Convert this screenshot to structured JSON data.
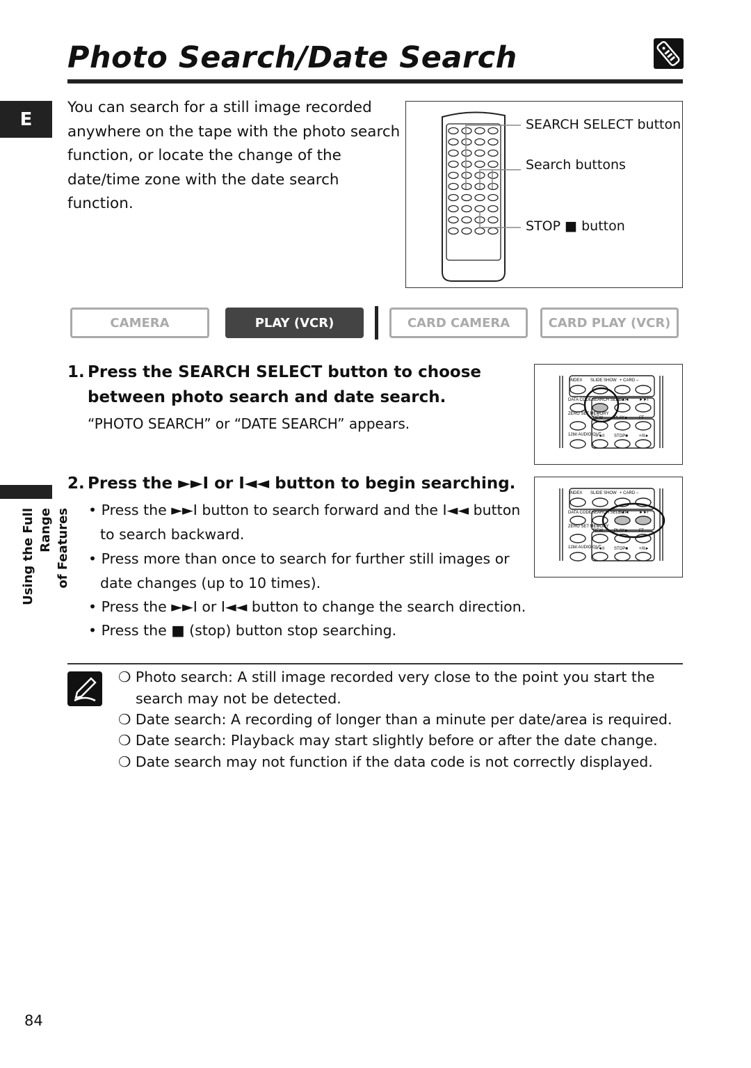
{
  "title": "Photo Search/Date Search",
  "language_tab": "E",
  "intro": "You can search for a still image recorded anywhere on the tape with the photo search function, or locate the change of the date/time zone with the date search function.",
  "diagram": {
    "labels": [
      "SEARCH SELECT button",
      "Search buttons",
      "STOP ■ button"
    ]
  },
  "modes": [
    {
      "label": "CAMERA",
      "active": false
    },
    {
      "label": "PLAY (VCR)",
      "active": true
    },
    {
      "label": "CARD CAMERA",
      "active": false
    },
    {
      "label": "CARD PLAY (VCR)",
      "active": false
    }
  ],
  "steps": [
    {
      "num": "1.",
      "text": "Press the SEARCH SELECT button to choose between photo search and date search.",
      "sub": "“PHOTO SEARCH” or “DATE SEARCH” appears."
    },
    {
      "num": "2.",
      "text": "Press the ►►I or I◄◄ button to begin searching.",
      "bullets": [
        "• Press the ►►I button to search forward and the I◄◄ button to search backward.",
        "• Press more than once to search for further still images or date changes (up to 10 times).",
        "• Press the ►►I or I◄◄ button to change the search direction.",
        "• Press the ■ (stop) button stop searching."
      ]
    }
  ],
  "remote_closeup": {
    "labels": [
      "INDEX",
      "SLIDE SHOW",
      "+ CARD –",
      "DATA CODE",
      "SEARCH SELECT",
      "I◄◄",
      "►►I",
      "ZERO SET MEMORY",
      "REW",
      "PLAY►",
      "FF",
      "12bit AUDIO OUT",
      "–/◄II",
      "STOP■",
      "+/II►"
    ]
  },
  "sidebar": {
    "line1": "Using the Full Range",
    "line2": "of Features"
  },
  "notes": [
    "❍ Photo search: A still image recorded very close to the point you start the search may not be detected.",
    "❍ Date search: A recording of longer than a minute per date/area is required.",
    "❍ Date search: Playback may start slightly before or after the date change.",
    "❍ Date search may not function if the data code is not correctly displayed."
  ],
  "page_number": "84",
  "icons": {
    "title": "remote-control-icon",
    "note": "pencil-note-icon"
  }
}
